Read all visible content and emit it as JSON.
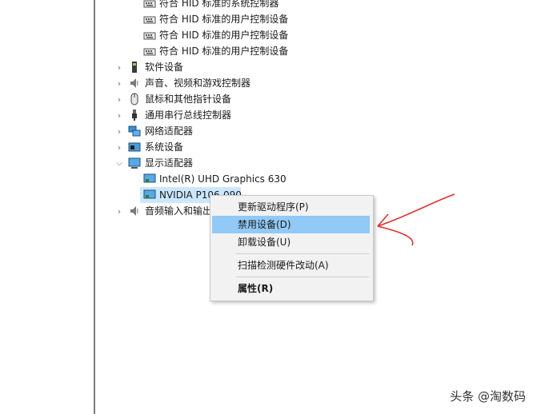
{
  "tree": {
    "hid_items": [
      "符合 HID 标准的系统控制器",
      "符合 HID 标准的用户控制设备",
      "符合 HID 标准的用户控制设备",
      "符合 HID 标准的用户控制设备"
    ],
    "categories": [
      {
        "label": "软件设备",
        "icon": "chip-icon"
      },
      {
        "label": "声音、视频和游戏控制器",
        "icon": "speaker-icon"
      },
      {
        "label": "鼠标和其他指针设备",
        "icon": "mouse-icon"
      },
      {
        "label": "通用串行总线控制器",
        "icon": "usb-icon"
      },
      {
        "label": "网络适配器",
        "icon": "network-icon"
      },
      {
        "label": "系统设备",
        "icon": "system-device-icon"
      }
    ],
    "display_adapters": {
      "label": "显示适配器",
      "children": [
        "Intel(R) UHD Graphics 630",
        "NVIDIA P106-090"
      ]
    },
    "audio_io": "音频输入和输出"
  },
  "context_menu": {
    "items": [
      {
        "label": "更新驱动程序(P)"
      },
      {
        "label": "禁用设备(D)"
      },
      {
        "label": "卸载设备(U)"
      },
      {
        "label": "扫描检测硬件改动(A)"
      },
      {
        "label": "属性(R)"
      }
    ],
    "highlighted_index": 1
  },
  "watermark": "头条 @淘数码",
  "annotation_color": "#e0302a"
}
